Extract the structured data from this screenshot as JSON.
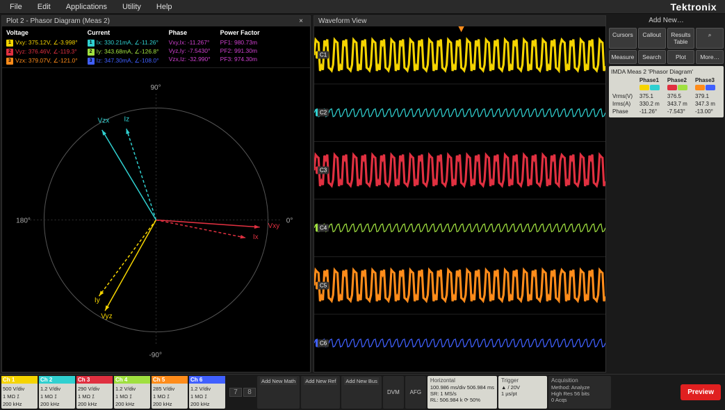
{
  "menu": {
    "file": "File",
    "edit": "Edit",
    "applications": "Applications",
    "utility": "Utility",
    "help": "Help"
  },
  "brand": "Tektronix",
  "phasor_panel": {
    "title": "Plot 2 - Phasor Diagram (Meas 2)",
    "axis": {
      "deg0": "0°",
      "deg90": "90°",
      "deg180": "180°",
      "deg270": "-90°"
    },
    "columns": {
      "voltage": "Voltage",
      "current": "Current",
      "phase": "Phase",
      "pf": "Power Factor"
    },
    "voltage": [
      {
        "color": "#f5d400",
        "label": "Vxy: 375.12V, ∠-3.998°"
      },
      {
        "color": "#e03040",
        "label": "Vyz: 376.46V, ∠-119.3°"
      },
      {
        "color": "#ff8c1a",
        "label": "Vzx: 379.07V, ∠-121.0°"
      }
    ],
    "current": [
      {
        "color": "#30d0d0",
        "label": "Ix: 330.21mA, ∠-11.26°"
      },
      {
        "color": "#a0e040",
        "label": "Iy: 343.68mA, ∠-126.8°"
      },
      {
        "color": "#4060ff",
        "label": "Iz: 347.30mA, ∠-108.0°"
      }
    ],
    "phase": [
      {
        "label": "Vxy,Ix: -11.267°"
      },
      {
        "label": "Vyz,Iy: -7.5430°"
      },
      {
        "label": "Vzx,Iz: -32.990°"
      }
    ],
    "pf": [
      {
        "label": "PF1: 980.73m"
      },
      {
        "label": "PF2: 991.30m"
      },
      {
        "label": "PF3: 974.30m"
      }
    ],
    "vector_labels": {
      "vxy": "Vxy",
      "vyz": "Vyz",
      "vzx": "Vzx",
      "ix": "Ix",
      "iy": "Iy",
      "iz": "Iz"
    }
  },
  "waveform_panel": {
    "title": "Waveform View"
  },
  "channels": [
    {
      "id": "C1",
      "color": "#f5d400",
      "scale": "500 V/div",
      "coupling": "1 MΩ  ⁒",
      "bw": "200 kHz"
    },
    {
      "id": "C2",
      "color": "#30d0d0",
      "scale": "1.2 V/div",
      "coupling": "1 MΩ  ⁒",
      "bw": "200 kHz"
    },
    {
      "id": "C3",
      "color": "#e03040",
      "scale": "290 V/div",
      "coupling": "1 MΩ  ⁒",
      "bw": "200 kHz"
    },
    {
      "id": "C4",
      "color": "#a0e040",
      "scale": "1.2 V/div",
      "coupling": "1 MΩ  ⁒",
      "bw": "200 kHz"
    },
    {
      "id": "C5",
      "color": "#ff8c1a",
      "scale": "285 V/div",
      "coupling": "1 MΩ  ⁒",
      "bw": "200 kHz"
    },
    {
      "id": "C6",
      "color": "#4060ff",
      "scale": "1.2 V/div",
      "coupling": "1 MΩ  ⁒",
      "bw": "200 kHz"
    }
  ],
  "bottom": {
    "slots": [
      "7",
      "8"
    ],
    "add_group": {
      "math": "Add New Math",
      "ref": "Add New Ref",
      "bus": "Add New Bus"
    },
    "dvm": "DVM",
    "afg": "AFG",
    "horizontal": {
      "title": "Horizontal",
      "a": "100.986 ms/div  506.984 ms",
      "b": "SR: 1 MS/s",
      "c": "RL: 506.984 k      ⟳ 50%"
    },
    "trigger": {
      "title": "Trigger",
      "a": "▲  /  20V",
      "b": "1 µs/pt"
    },
    "acq": {
      "title": "Acquisition",
      "a": "Method:    Analyze",
      "b": "High Res   56 bits",
      "c": "0 Acqs"
    },
    "preview": "Preview"
  },
  "side": {
    "add_new": "Add New…",
    "buttons": [
      "Cursors",
      "Callout",
      "Results Table",
      "⌕",
      "Measure",
      "Search",
      "Plot",
      "More…"
    ],
    "results": {
      "title": "IMDA Meas 2 'Phasor Diagram'",
      "headers": [
        "",
        "Phase1",
        "Phase2",
        "Phase3"
      ],
      "chips": [
        [
          "#f5d400",
          "#30d0d0"
        ],
        [
          "#e03040",
          "#a0e040"
        ],
        [
          "#ff8c1a",
          "#4060ff"
        ]
      ],
      "rows": [
        {
          "name": "Vrms(V)",
          "v": [
            "375.1",
            "376.5",
            "379.1"
          ]
        },
        {
          "name": "Irms(A)",
          "v": [
            "330.2 m",
            "343.7 m",
            "347.3 m"
          ]
        },
        {
          "name": "Phase",
          "v": [
            "-11.26°",
            "-7.543°",
            "-13.00°"
          ]
        }
      ]
    }
  },
  "chart_data": {
    "type": "phasor",
    "vectors": [
      {
        "name": "Vxy",
        "mag": 375.12,
        "angle_deg": -3.998,
        "color": "#e03040"
      },
      {
        "name": "Vyz",
        "mag": 376.46,
        "angle_deg": -119.3,
        "color": "#f5d400"
      },
      {
        "name": "Vzx",
        "mag": 379.07,
        "angle_deg": 121.0,
        "color": "#30d0d0"
      },
      {
        "name": "Ix",
        "mag": 330.21,
        "angle_deg": -11.26,
        "color": "#e03040",
        "dash": true
      },
      {
        "name": "Iy",
        "mag": 343.68,
        "angle_deg": -126.8,
        "color": "#f5d400",
        "dash": true
      },
      {
        "name": "Iz",
        "mag": 347.3,
        "angle_deg": 108.0,
        "color": "#30d0d0",
        "dash": true
      }
    ]
  }
}
